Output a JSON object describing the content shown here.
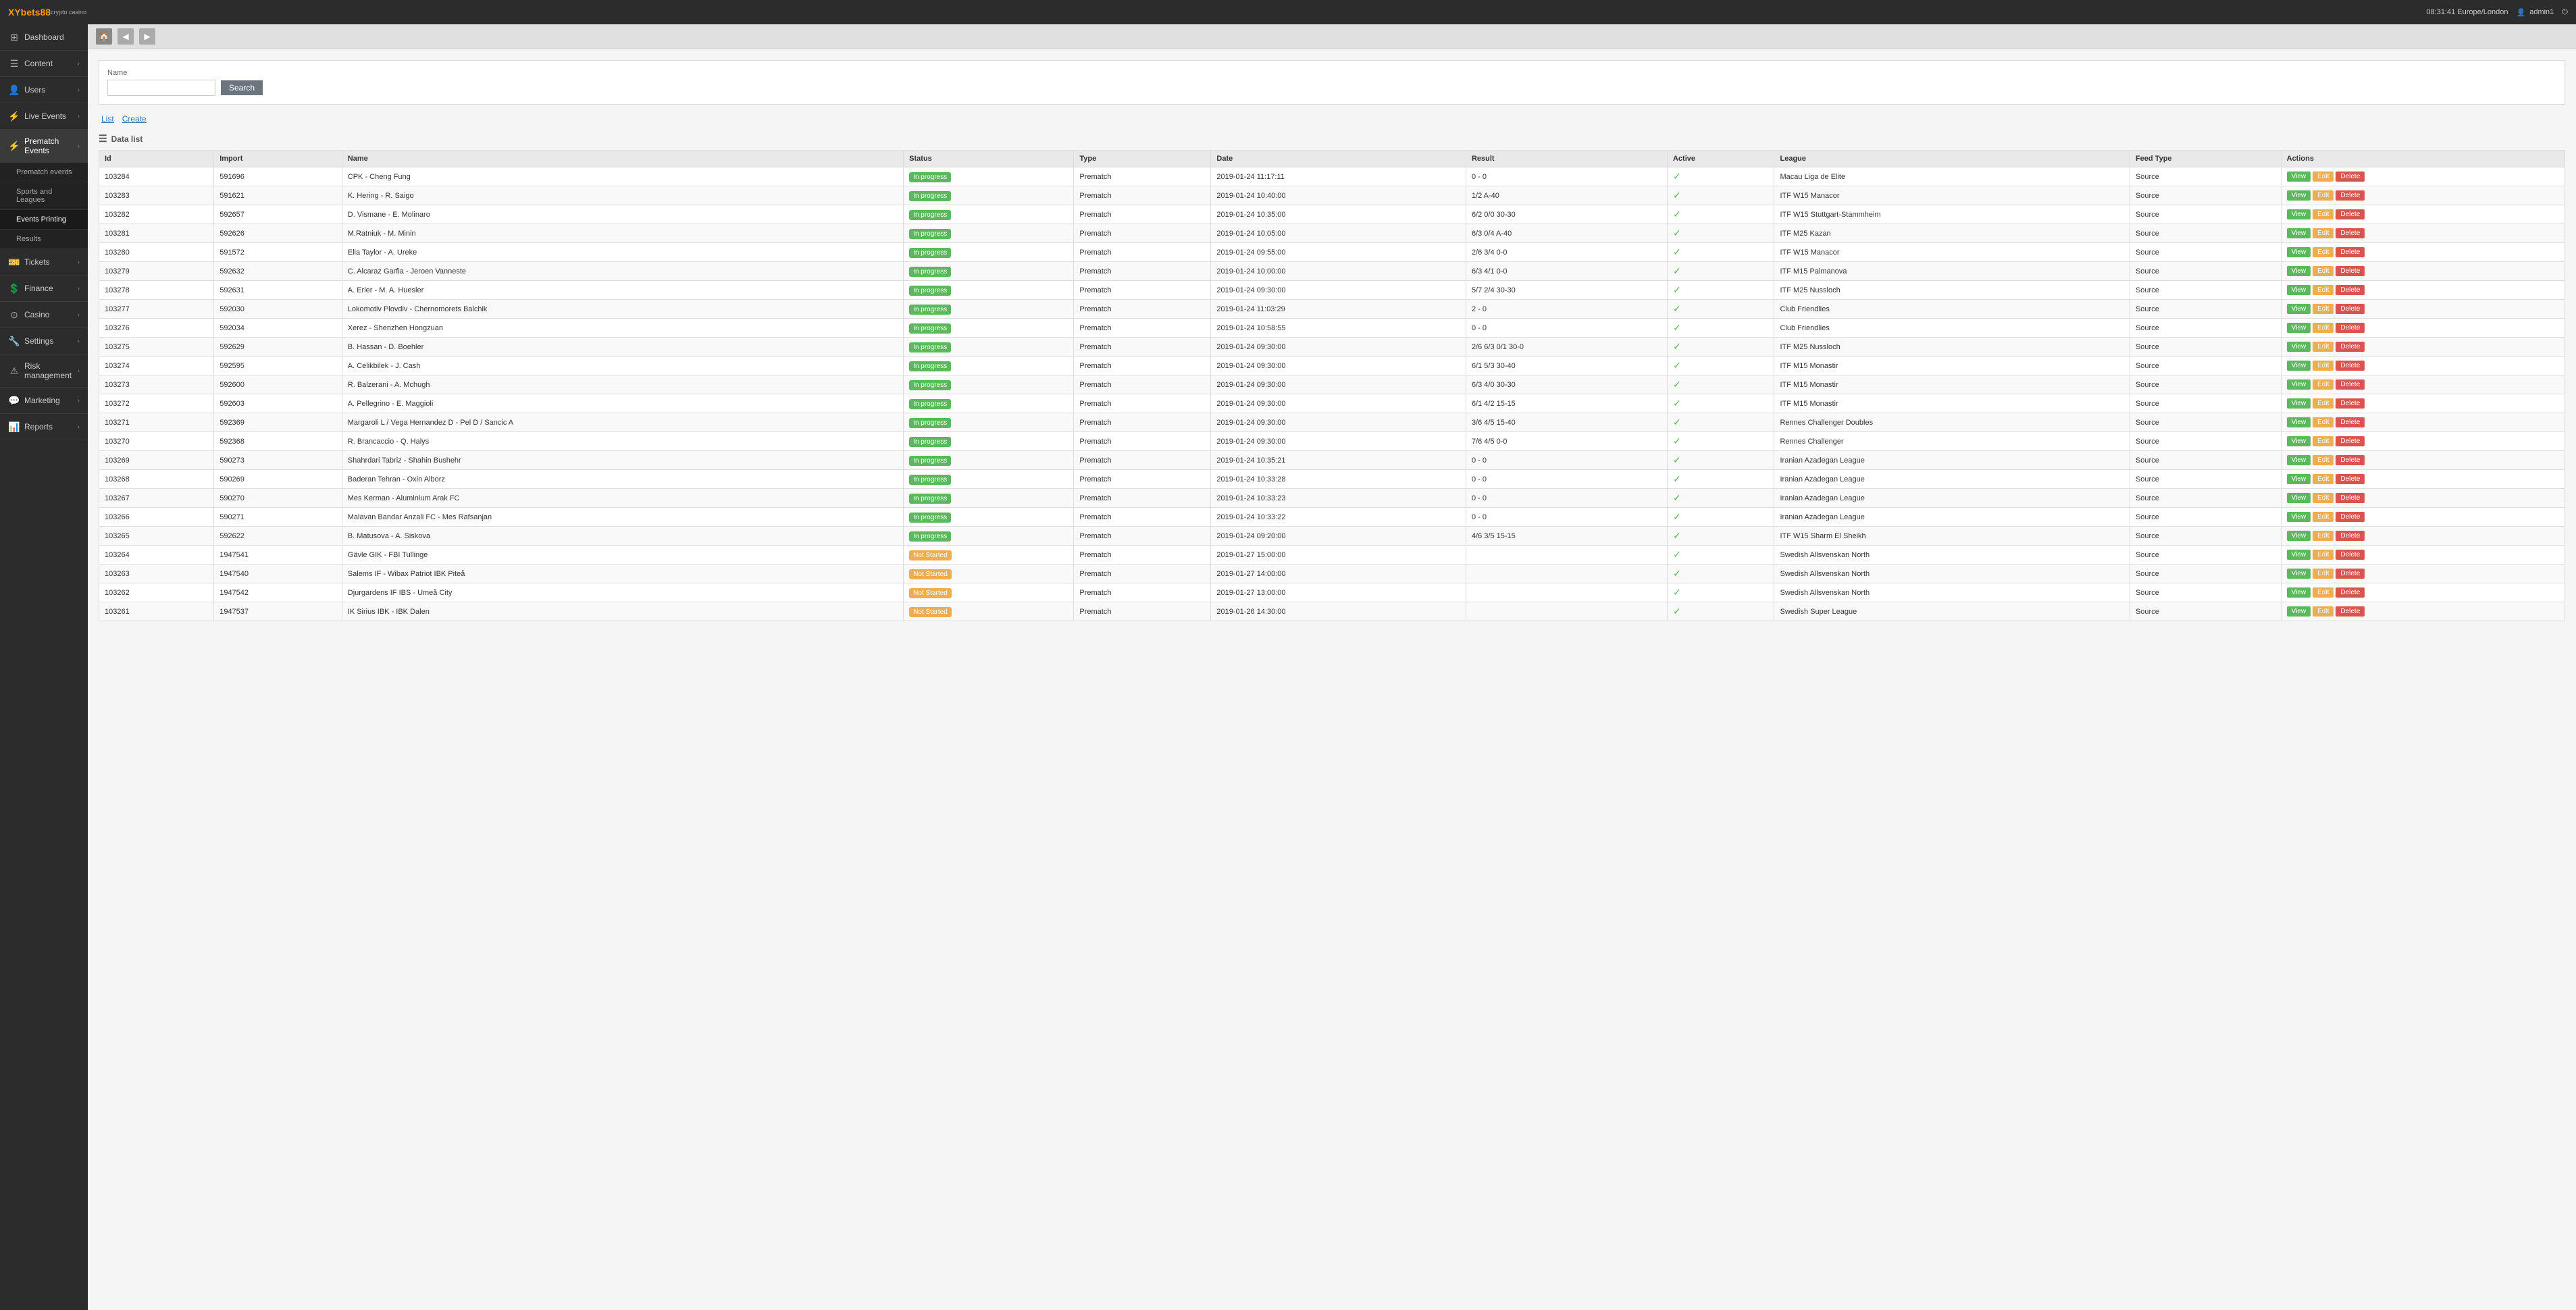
{
  "topbar": {
    "logo": "XYbets88",
    "logo_sub": "crypto casino",
    "time": "08:31:41 Europe/London",
    "user": "admin1"
  },
  "sidebar": {
    "collapse_icon": "◀",
    "items": [
      {
        "id": "dashboard",
        "label": "Dashboard",
        "icon": "⊞",
        "has_arrow": false,
        "active": false
      },
      {
        "id": "content",
        "label": "Content",
        "icon": "☰",
        "has_arrow": true,
        "active": false
      },
      {
        "id": "users",
        "label": "Users",
        "icon": "👤",
        "has_arrow": true,
        "active": false
      },
      {
        "id": "live-events",
        "label": "Live Events",
        "icon": "⚡",
        "has_arrow": true,
        "active": false
      },
      {
        "id": "prematch-events",
        "label": "Prematch Events",
        "icon": "⚡",
        "has_arrow": true,
        "active": true
      }
    ],
    "sub_items": [
      {
        "id": "prematch-events-sub",
        "label": "Prematch events",
        "active": false
      },
      {
        "id": "sports-and-leagues",
        "label": "Sports and Leagues",
        "active": false
      },
      {
        "id": "events-printing",
        "label": "Events Printing",
        "active": true
      },
      {
        "id": "results",
        "label": "Results",
        "active": false
      }
    ],
    "bottom_items": [
      {
        "id": "tickets",
        "label": "Tickets",
        "icon": "🎫",
        "has_arrow": true
      },
      {
        "id": "finance",
        "label": "Finance",
        "icon": "💲",
        "has_arrow": true
      },
      {
        "id": "casino",
        "label": "Casino",
        "icon": "⊙",
        "has_arrow": true
      },
      {
        "id": "settings",
        "label": "Settings",
        "icon": "🔧",
        "has_arrow": true
      },
      {
        "id": "risk-management",
        "label": "Risk management",
        "icon": "⚠",
        "has_arrow": true
      },
      {
        "id": "marketing",
        "label": "Marketing",
        "icon": "💬",
        "has_arrow": true
      },
      {
        "id": "reports",
        "label": "Reports",
        "icon": "📊",
        "has_arrow": true
      }
    ]
  },
  "breadcrumb": {
    "home_icon": "🏠"
  },
  "search": {
    "label": "Name",
    "placeholder": "",
    "button_label": "Search"
  },
  "tabs": [
    {
      "id": "list",
      "label": "List"
    },
    {
      "id": "create",
      "label": "Create"
    }
  ],
  "data_list": {
    "header": "Data list",
    "columns": [
      "Id",
      "Import",
      "Name",
      "Status",
      "Type",
      "Date",
      "Result",
      "Active",
      "League",
      "Feed Type",
      "Actions"
    ],
    "rows": [
      {
        "id": "103284",
        "import": "591696",
        "name": "CPK - Cheng Fung",
        "status": "In progress",
        "type": "Prematch",
        "date": "2019-01-24 11:17:11",
        "result": "0 - 0",
        "active": true,
        "league": "Macau Liga de Elite",
        "feed_type": "Source"
      },
      {
        "id": "103283",
        "import": "591621",
        "name": "K. Hering - R. Saigo",
        "status": "In progress",
        "type": "Prematch",
        "date": "2019-01-24 10:40:00",
        "result": "1/2 A-40",
        "active": true,
        "league": "ITF W15 Manacor",
        "feed_type": "Source"
      },
      {
        "id": "103282",
        "import": "592657",
        "name": "D. Vismane - E. Molinaro",
        "status": "In progress",
        "type": "Prematch",
        "date": "2019-01-24 10:35:00",
        "result": "6/2 0/0 30-30",
        "active": true,
        "league": "ITF W15 Stuttgart-Stammheim",
        "feed_type": "Source"
      },
      {
        "id": "103281",
        "import": "592626",
        "name": "M.Ratniuk - M. Minin",
        "status": "In progress",
        "type": "Prematch",
        "date": "2019-01-24 10:05:00",
        "result": "6/3 0/4 A-40",
        "active": true,
        "league": "ITF M25 Kazan",
        "feed_type": "Source"
      },
      {
        "id": "103280",
        "import": "591572",
        "name": "Ella Taylor - A. Ureke",
        "status": "In progress",
        "type": "Prematch",
        "date": "2019-01-24 09:55:00",
        "result": "2/6 3/4 0-0",
        "active": true,
        "league": "ITF W15 Manacor",
        "feed_type": "Source"
      },
      {
        "id": "103279",
        "import": "592632",
        "name": "C. Alcaraz Garfia - Jeroen Vanneste",
        "status": "In progress",
        "type": "Prematch",
        "date": "2019-01-24 10:00:00",
        "result": "6/3 4/1 0-0",
        "active": true,
        "league": "ITF M15 Palmanova",
        "feed_type": "Source"
      },
      {
        "id": "103278",
        "import": "592631",
        "name": "A. Erler - M. A. Huesler",
        "status": "In progress",
        "type": "Prematch",
        "date": "2019-01-24 09:30:00",
        "result": "5/7 2/4 30-30",
        "active": true,
        "league": "ITF M25 Nussloch",
        "feed_type": "Source"
      },
      {
        "id": "103277",
        "import": "592030",
        "name": "Lokomotiv Plovdiv - Chernomorets Balchik",
        "status": "In progress",
        "type": "Prematch",
        "date": "2019-01-24 11:03:29",
        "result": "2 - 0",
        "active": true,
        "league": "Club Friendlies",
        "feed_type": "Source"
      },
      {
        "id": "103276",
        "import": "592034",
        "name": "Xerez - Shenzhen Hongzuan",
        "status": "In progress",
        "type": "Prematch",
        "date": "2019-01-24 10:58:55",
        "result": "0 - 0",
        "active": true,
        "league": "Club Friendlies",
        "feed_type": "Source"
      },
      {
        "id": "103275",
        "import": "592629",
        "name": "B. Hassan - D. Boehler",
        "status": "In progress",
        "type": "Prematch",
        "date": "2019-01-24 09:30:00",
        "result": "2/6 6/3 0/1 30-0",
        "active": true,
        "league": "ITF M25 Nussloch",
        "feed_type": "Source"
      },
      {
        "id": "103274",
        "import": "592595",
        "name": "A. Celikbilek - J. Cash",
        "status": "In progress",
        "type": "Prematch",
        "date": "2019-01-24 09:30:00",
        "result": "6/1 5/3 30-40",
        "active": true,
        "league": "ITF M15 Monastir",
        "feed_type": "Source"
      },
      {
        "id": "103273",
        "import": "592600",
        "name": "R. Balzerani - A. Mchugh",
        "status": "In progress",
        "type": "Prematch",
        "date": "2019-01-24 09:30:00",
        "result": "6/3 4/0 30-30",
        "active": true,
        "league": "ITF M15 Monastir",
        "feed_type": "Source"
      },
      {
        "id": "103272",
        "import": "592603",
        "name": "A. Pellegrino - E. Maggioli",
        "status": "In progress",
        "type": "Prematch",
        "date": "2019-01-24 09:30:00",
        "result": "6/1 4/2 15-15",
        "active": true,
        "league": "ITF M15 Monastir",
        "feed_type": "Source"
      },
      {
        "id": "103271",
        "import": "592369",
        "name": "Margaroli L / Vega Hernandez D - Pel D / Sancic A",
        "status": "In progress",
        "type": "Prematch",
        "date": "2019-01-24 09:30:00",
        "result": "3/6 4/5 15-40",
        "active": true,
        "league": "Rennes Challenger Doubles",
        "feed_type": "Source"
      },
      {
        "id": "103270",
        "import": "592368",
        "name": "R. Brancaccio - Q. Halys",
        "status": "In progress",
        "type": "Prematch",
        "date": "2019-01-24 09:30:00",
        "result": "7/6 4/5 0-0",
        "active": true,
        "league": "Rennes Challenger",
        "feed_type": "Source"
      },
      {
        "id": "103269",
        "import": "590273",
        "name": "Shahrdari Tabriz - Shahin Bushehr",
        "status": "In progress",
        "type": "Prematch",
        "date": "2019-01-24 10:35:21",
        "result": "0 - 0",
        "active": true,
        "league": "Iranian Azadegan League",
        "feed_type": "Source"
      },
      {
        "id": "103268",
        "import": "590269",
        "name": "Baderan Tehran - Oxin Alborz",
        "status": "In progress",
        "type": "Prematch",
        "date": "2019-01-24 10:33:28",
        "result": "0 - 0",
        "active": true,
        "league": "Iranian Azadegan League",
        "feed_type": "Source"
      },
      {
        "id": "103267",
        "import": "590270",
        "name": "Mes Kerman - Aluminium Arak FC",
        "status": "In progress",
        "type": "Prematch",
        "date": "2019-01-24 10:33:23",
        "result": "0 - 0",
        "active": true,
        "league": "Iranian Azadegan League",
        "feed_type": "Source"
      },
      {
        "id": "103266",
        "import": "590271",
        "name": "Malavan Bandar Anzali FC - Mes Rafsanjan",
        "status": "In progress",
        "type": "Prematch",
        "date": "2019-01-24 10:33:22",
        "result": "0 - 0",
        "active": true,
        "league": "Iranian Azadegan League",
        "feed_type": "Source"
      },
      {
        "id": "103265",
        "import": "592622",
        "name": "B. Matusova - A. Siskova",
        "status": "In progress",
        "type": "Prematch",
        "date": "2019-01-24 09:20:00",
        "result": "4/6 3/5 15-15",
        "active": true,
        "league": "ITF W15 Sharm El Sheikh",
        "feed_type": "Source"
      },
      {
        "id": "103264",
        "import": "1947541",
        "name": "Gävle GIK - FBI Tullinge",
        "status": "Not Started",
        "type": "Prematch",
        "date": "2019-01-27 15:00:00",
        "result": "",
        "active": true,
        "league": "Swedish Allsvenskan North",
        "feed_type": "Source"
      },
      {
        "id": "103263",
        "import": "1947540",
        "name": "Salems IF - Wibax Patriot IBK Piteå",
        "status": "Not Started",
        "type": "Prematch",
        "date": "2019-01-27 14:00:00",
        "result": "",
        "active": true,
        "league": "Swedish Allsvenskan North",
        "feed_type": "Source"
      },
      {
        "id": "103262",
        "import": "1947542",
        "name": "Djurgardens IF IBS - Umeå City",
        "status": "Not Started",
        "type": "Prematch",
        "date": "2019-01-27 13:00:00",
        "result": "",
        "active": true,
        "league": "Swedish Allsvenskan North",
        "feed_type": "Source"
      },
      {
        "id": "103261",
        "import": "1947537",
        "name": "IK Sirius IBK - IBK Dalen",
        "status": "Not Started",
        "type": "Prematch",
        "date": "2019-01-26 14:30:00",
        "result": "",
        "active": true,
        "league": "Swedish Super League",
        "feed_type": "Source"
      }
    ],
    "action_labels": {
      "view": "View",
      "edit": "Edit",
      "delete": "Delete"
    }
  }
}
